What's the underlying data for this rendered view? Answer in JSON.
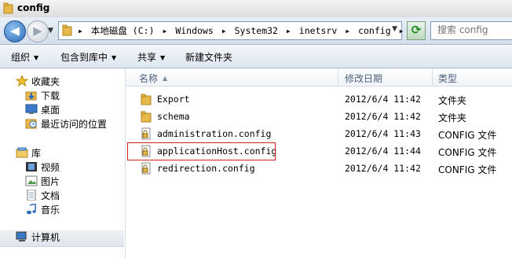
{
  "window": {
    "title": "config"
  },
  "nav": {
    "back_glyph": "◀",
    "forward_glyph": "▶",
    "breadcrumbs": [
      "本地磁盘 (C:)",
      "Windows",
      "System32",
      "inetsrv",
      "config"
    ],
    "refresh_glyph": "⟳",
    "search_placeholder": "搜索 config"
  },
  "toolbar": {
    "organize": "组织",
    "include_library": "包含到库中",
    "share": "共享",
    "new_folder": "新建文件夹"
  },
  "sidebar": {
    "favorites": "收藏夹",
    "downloads": "下载",
    "desktop": "桌面",
    "recent": "最近访问的位置",
    "libraries": "库",
    "videos": "视频",
    "pictures": "图片",
    "documents": "文档",
    "music": "音乐",
    "computer": "计算机"
  },
  "columns": {
    "name": "名称",
    "modified": "修改日期",
    "type": "类型"
  },
  "files": [
    {
      "name": "Export",
      "modified": "2012/6/4 11:42",
      "type": "文件夹",
      "icon": "folder-icon"
    },
    {
      "name": "schema",
      "modified": "2012/6/4 11:42",
      "type": "文件夹",
      "icon": "folder-icon"
    },
    {
      "name": "administration.config",
      "modified": "2012/6/4 11:43",
      "type": "CONFIG 文件",
      "icon": "locked-config-file-icon"
    },
    {
      "name": "applicationHost.config",
      "modified": "2012/6/4 11:44",
      "type": "CONFIG 文件",
      "icon": "locked-config-file-icon"
    },
    {
      "name": "redirection.config",
      "modified": "2012/6/4 11:42",
      "type": "CONFIG 文件",
      "icon": "locked-config-file-icon"
    }
  ],
  "highlighted_file": "applicationHost.config",
  "colors": {
    "highlight_border": "#d21f1f",
    "folder": "#e8b84a",
    "accent": "#2c6cb8"
  }
}
